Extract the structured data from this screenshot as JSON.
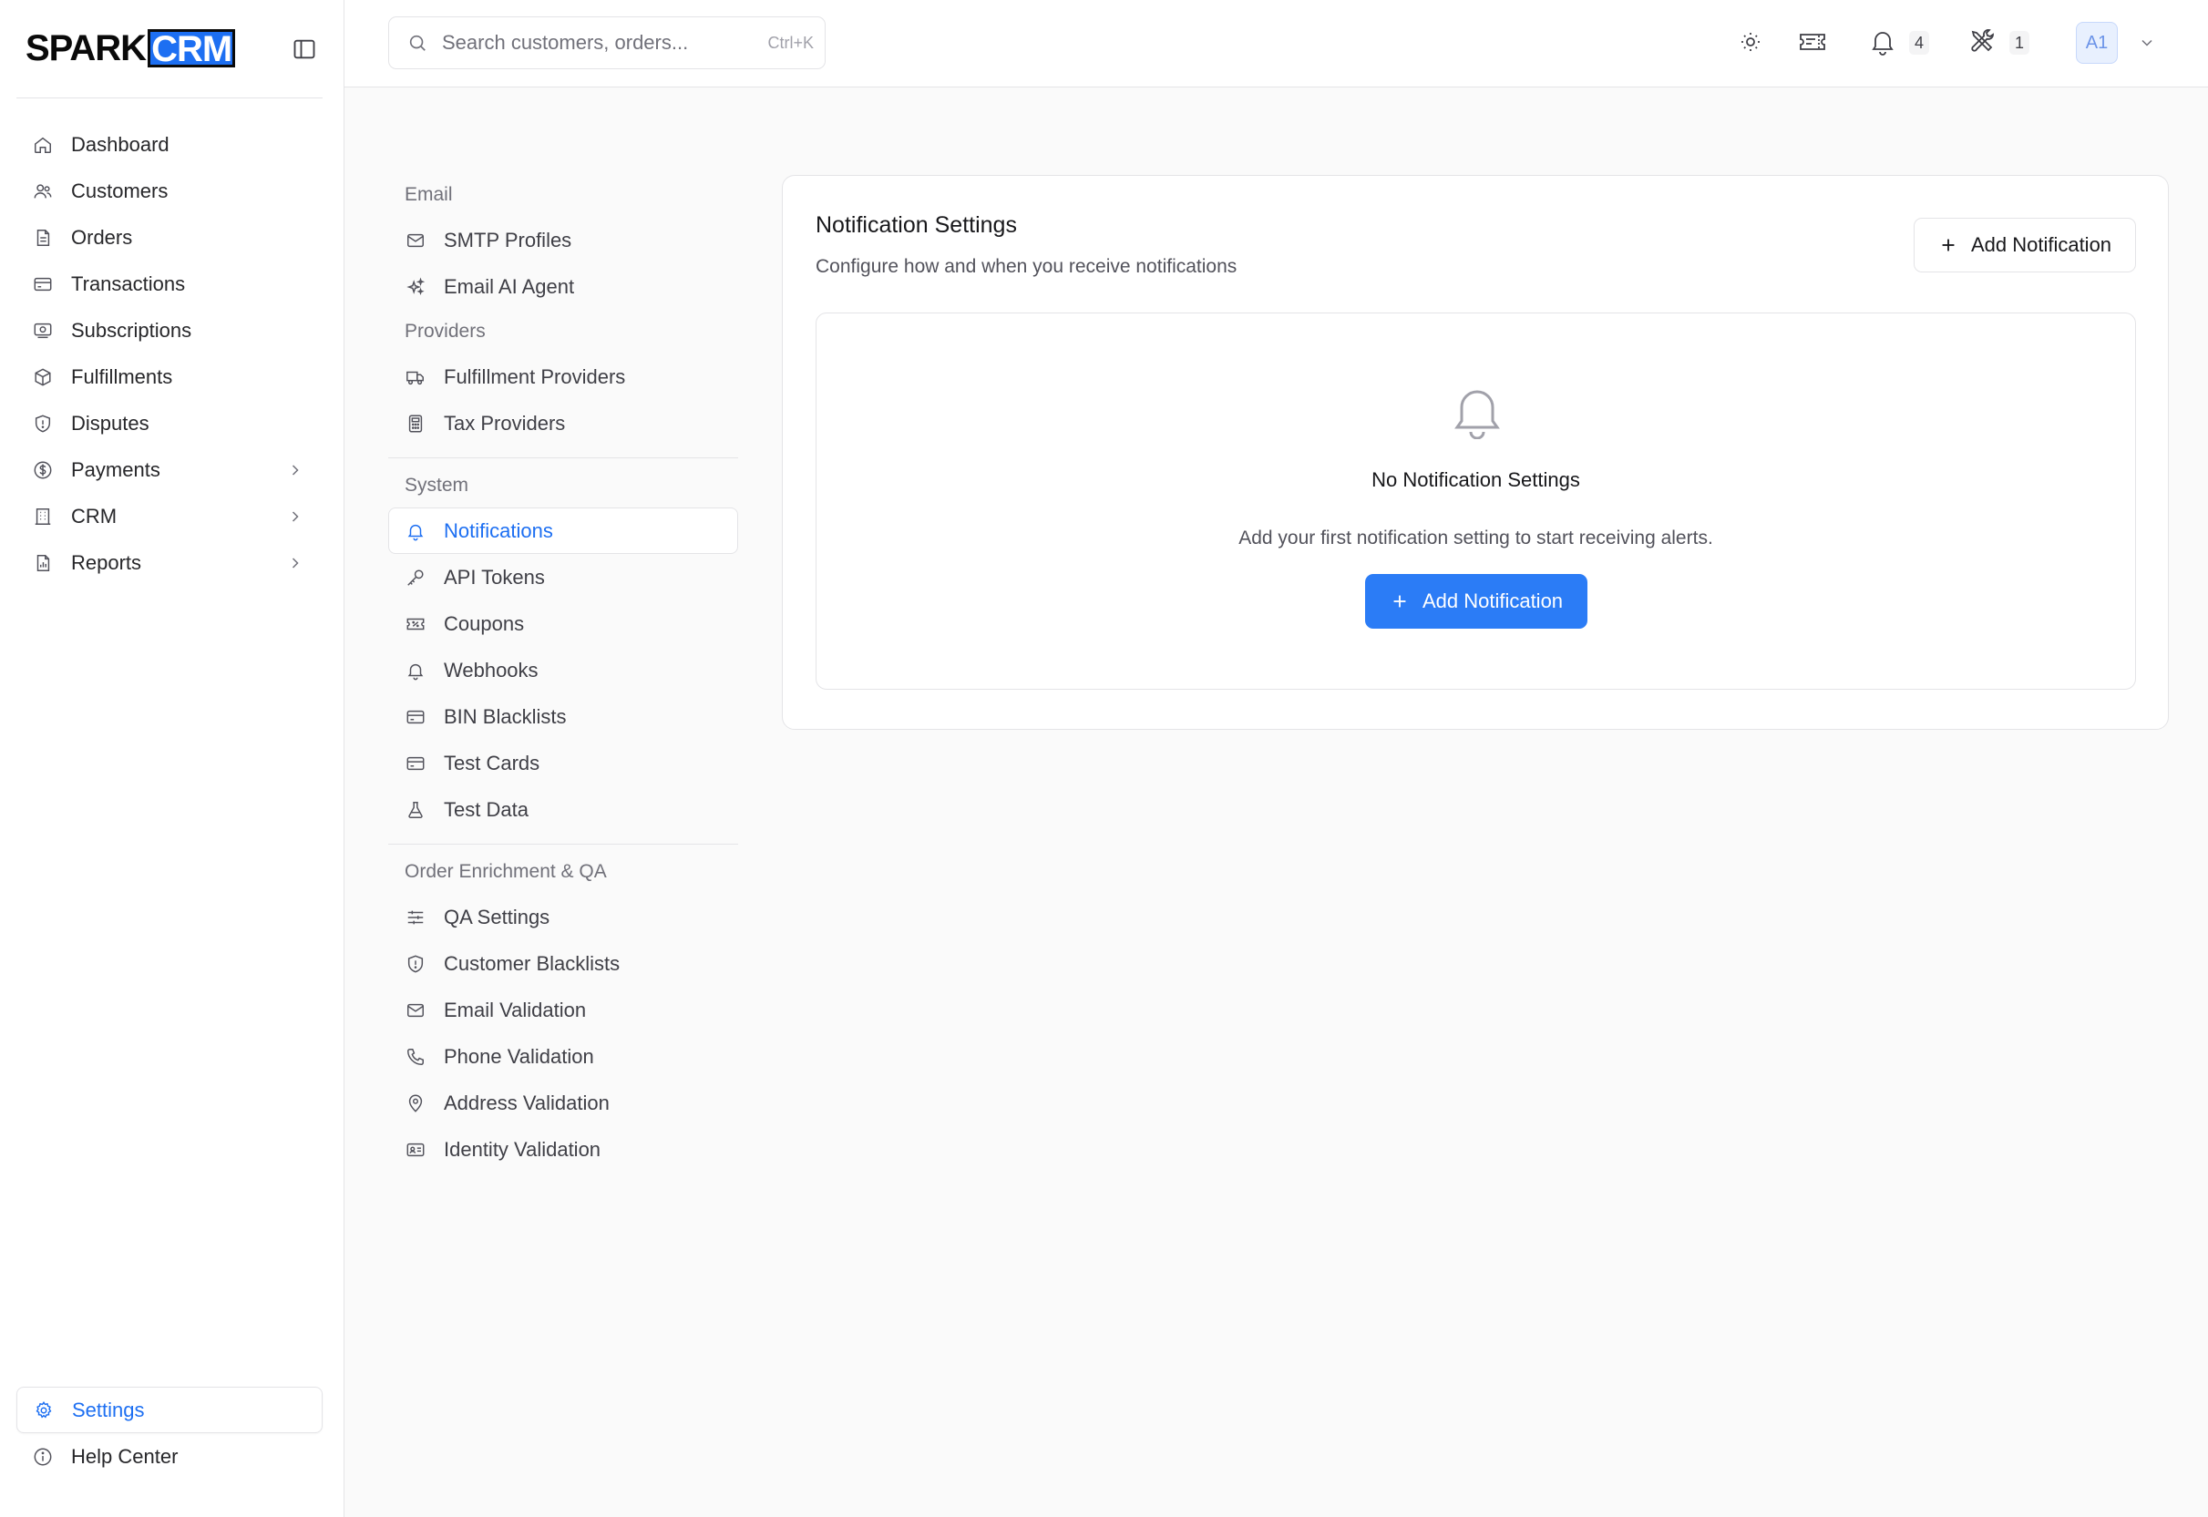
{
  "brand": {
    "part1": "SPARK",
    "part2": "CRM",
    "accent": "#1d6ff2"
  },
  "sidebar": {
    "items": [
      {
        "label": "Dashboard",
        "icon": "home-icon"
      },
      {
        "label": "Customers",
        "icon": "users-icon"
      },
      {
        "label": "Orders",
        "icon": "file-icon"
      },
      {
        "label": "Transactions",
        "icon": "credit-card-icon"
      },
      {
        "label": "Subscriptions",
        "icon": "subscription-icon"
      },
      {
        "label": "Fulfillments",
        "icon": "package-icon"
      },
      {
        "label": "Disputes",
        "icon": "shield-icon"
      },
      {
        "label": "Payments",
        "icon": "dollar-icon",
        "expandable": true
      },
      {
        "label": "CRM",
        "icon": "building-icon",
        "expandable": true
      },
      {
        "label": "Reports",
        "icon": "report-icon",
        "expandable": true
      }
    ],
    "bottom": [
      {
        "label": "Settings",
        "icon": "gear-icon",
        "active": true
      },
      {
        "label": "Help Center",
        "icon": "info-icon"
      }
    ]
  },
  "topbar": {
    "search_placeholder": "Search customers, orders...",
    "search_shortcut": "Ctrl+K",
    "notification_count": "4",
    "tools_count": "1",
    "avatar_initials": "A1"
  },
  "settings_nav": {
    "email": {
      "heading": "Email",
      "items": [
        {
          "label": "SMTP Profiles",
          "icon": "mail-icon"
        },
        {
          "label": "Email AI Agent",
          "icon": "sparkles-icon"
        }
      ]
    },
    "providers": {
      "heading": "Providers",
      "items": [
        {
          "label": "Fulfillment Providers",
          "icon": "truck-icon"
        },
        {
          "label": "Tax Providers",
          "icon": "calculator-icon"
        }
      ]
    },
    "system": {
      "heading": "System",
      "items": [
        {
          "label": "Notifications",
          "icon": "bell-icon",
          "active": true
        },
        {
          "label": "API Tokens",
          "icon": "key-icon"
        },
        {
          "label": "Coupons",
          "icon": "ticket-icon"
        },
        {
          "label": "Webhooks",
          "icon": "bell-icon"
        },
        {
          "label": "BIN Blacklists",
          "icon": "credit-card-icon"
        },
        {
          "label": "Test Cards",
          "icon": "credit-card-icon"
        },
        {
          "label": "Test Data",
          "icon": "flask-icon"
        }
      ]
    },
    "qa": {
      "heading": "Order Enrichment & QA",
      "items": [
        {
          "label": "QA Settings",
          "icon": "sliders-icon"
        },
        {
          "label": "Customer Blacklists",
          "icon": "shield-icon"
        },
        {
          "label": "Email Validation",
          "icon": "mail-icon"
        },
        {
          "label": "Phone Validation",
          "icon": "phone-icon"
        },
        {
          "label": "Address Validation",
          "icon": "map-pin-icon"
        },
        {
          "label": "Identity Validation",
          "icon": "id-card-icon"
        }
      ]
    }
  },
  "main": {
    "title": "Notification Settings",
    "subtitle": "Configure how and when you receive notifications",
    "add_button": "Add Notification",
    "empty": {
      "title": "No Notification Settings",
      "description": "Add your first notification setting to start receiving alerts.",
      "button": "Add Notification"
    }
  }
}
